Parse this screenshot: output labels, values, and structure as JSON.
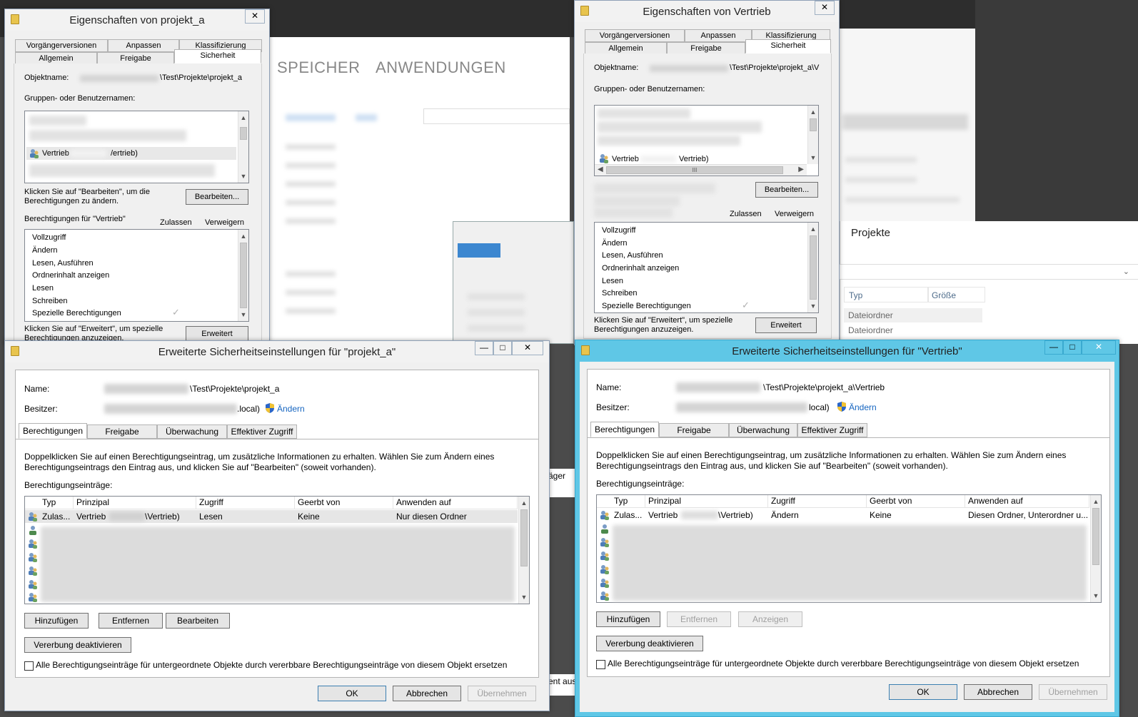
{
  "background": {
    "tabs": [
      "SPEICHER",
      "ANWENDUNGEN"
    ],
    "explorer": {
      "title": "Projekte",
      "col_type": "Typ",
      "col_size": "Größe",
      "rows": [
        "Dateiordner",
        "Dateiordner"
      ]
    },
    "partial_text_1": "äger",
    "partial_text_2": "ent aus"
  },
  "props_a": {
    "title": "Eigenschaften von projekt_a",
    "close": "✕",
    "tabs_row1": [
      "Vorgängerversionen",
      "Anpassen",
      "Klassifizierung"
    ],
    "tabs_row2": [
      "Allgemein",
      "Freigabe",
      "Sicherheit"
    ],
    "objname_label": "Objektname:",
    "objname_value": "\\Test\\Projekte\\projekt_a",
    "groups_label": "Gruppen- oder Benutzernamen:",
    "user_name": "Vertrieb",
    "user_suffix": "/ertrieb)",
    "edit_hint": "Klicken Sie auf \"Bearbeiten\", um die Berechtigungen zu ändern.",
    "edit_button": "Bearbeiten...",
    "perms_for": "Berechtigungen für \"Vertrieb\"",
    "allow": "Zulassen",
    "deny": "Verweigern",
    "perms": [
      "Vollzugriff",
      "Ändern",
      "Lesen, Ausführen",
      "Ordnerinhalt anzeigen",
      "Lesen",
      "Schreiben",
      "Spezielle Berechtigungen"
    ],
    "adv_hint": "Klicken Sie auf \"Erweitert\", um spezielle Berechtigungen anzuzeigen.",
    "adv_button": "Erweitert"
  },
  "props_v": {
    "title": "Eigenschaften von Vertrieb",
    "close": "✕",
    "tabs_row1": [
      "Vorgängerversionen",
      "Anpassen",
      "Klassifizierung"
    ],
    "tabs_row2": [
      "Allgemein",
      "Freigabe",
      "Sicherheit"
    ],
    "objname_label": "Objektname:",
    "objname_value": "\\Test\\Projekte\\projekt_a\\V",
    "groups_label": "Gruppen- oder Benutzernamen:",
    "user_name": "Vertrieb",
    "user_suffix": "Vertrieb)",
    "hscroll_thumb": "III",
    "edit_button": "Bearbeiten...",
    "allow": "Zulassen",
    "deny": "Verweigern",
    "perms": [
      "Vollzugriff",
      "Ändern",
      "Lesen, Ausführen",
      "Ordnerinhalt anzeigen",
      "Lesen",
      "Schreiben",
      "Spezielle Berechtigungen"
    ],
    "adv_hint": "Klicken Sie auf \"Erweitert\", um spezielle Berechtigungen anzuzeigen.",
    "adv_button": "Erweitert"
  },
  "adv_a": {
    "title": "Erweiterte Sicherheitseinstellungen für \"projekt_a\"",
    "min": "—",
    "max": "□",
    "close": "✕",
    "name_label": "Name:",
    "name_value": "\\Test\\Projekte\\projekt_a",
    "owner_label": "Besitzer:",
    "owner_value": ".local)",
    "change_link": "Ändern",
    "tabs": [
      "Berechtigungen",
      "Freigabe",
      "Überwachung",
      "Effektiver Zugriff"
    ],
    "info": "Doppelklicken Sie auf einen Berechtigungseintrag, um zusätzliche Informationen zu erhalten. Wählen Sie zum Ändern eines Berechtigungseintrags den Eintrag aus, und klicken Sie auf \"Bearbeiten\" (soweit vorhanden).",
    "entries_label": "Berechtigungseinträge:",
    "columns": [
      "Typ",
      "Prinzipal",
      "Zugriff",
      "Geerbt von",
      "Anwenden auf"
    ],
    "row": {
      "typ": "Zulas...",
      "principal": "Vertrieb",
      "principal_suffix": "\\Vertrieb)",
      "access": "Lesen",
      "inherited": "Keine",
      "apply": "Nur diesen Ordner"
    },
    "btn_add": "Hinzufügen",
    "btn_remove": "Entfernen",
    "btn_edit": "Bearbeiten",
    "btn_inherit": "Vererbung deaktivieren",
    "replace_label": "Alle Berechtigungseinträge für untergeordnete Objekte durch vererbbare Berechtigungseinträge von diesem Objekt ersetzen",
    "ok": "OK",
    "cancel": "Abbrechen",
    "apply": "Übernehmen"
  },
  "adv_v": {
    "title": "Erweiterte Sicherheitseinstellungen für \"Vertrieb\"",
    "min": "—",
    "max": "□",
    "close": "✕",
    "name_label": "Name:",
    "name_value": "\\Test\\Projekte\\projekt_a\\Vertrieb",
    "owner_label": "Besitzer:",
    "owner_value": "local)",
    "change_link": "Ändern",
    "tabs": [
      "Berechtigungen",
      "Freigabe",
      "Überwachung",
      "Effektiver Zugriff"
    ],
    "info": "Doppelklicken Sie auf einen Berechtigungseintrag, um zusätzliche Informationen zu erhalten. Wählen Sie zum Ändern eines Berechtigungseintrags den Eintrag aus, und klicken Sie auf \"Bearbeiten\" (soweit vorhanden).",
    "entries_label": "Berechtigungseinträge:",
    "columns": [
      "Typ",
      "Prinzipal",
      "Zugriff",
      "Geerbt von",
      "Anwenden auf"
    ],
    "row": {
      "typ": "Zulas...",
      "principal": "Vertrieb",
      "principal_suffix": "\\Vertrieb)",
      "access": "Ändern",
      "inherited": "Keine",
      "apply": "Diesen Ordner, Unterordner u..."
    },
    "btn_add": "Hinzufügen",
    "btn_remove": "Entfernen",
    "btn_view": "Anzeigen",
    "btn_inherit": "Vererbung deaktivieren",
    "replace_label": "Alle Berechtigungseinträge für untergeordnete Objekte durch vererbbare Berechtigungseinträge von diesem Objekt ersetzen",
    "ok": "OK",
    "cancel": "Abbrechen",
    "apply": "Übernehmen"
  }
}
